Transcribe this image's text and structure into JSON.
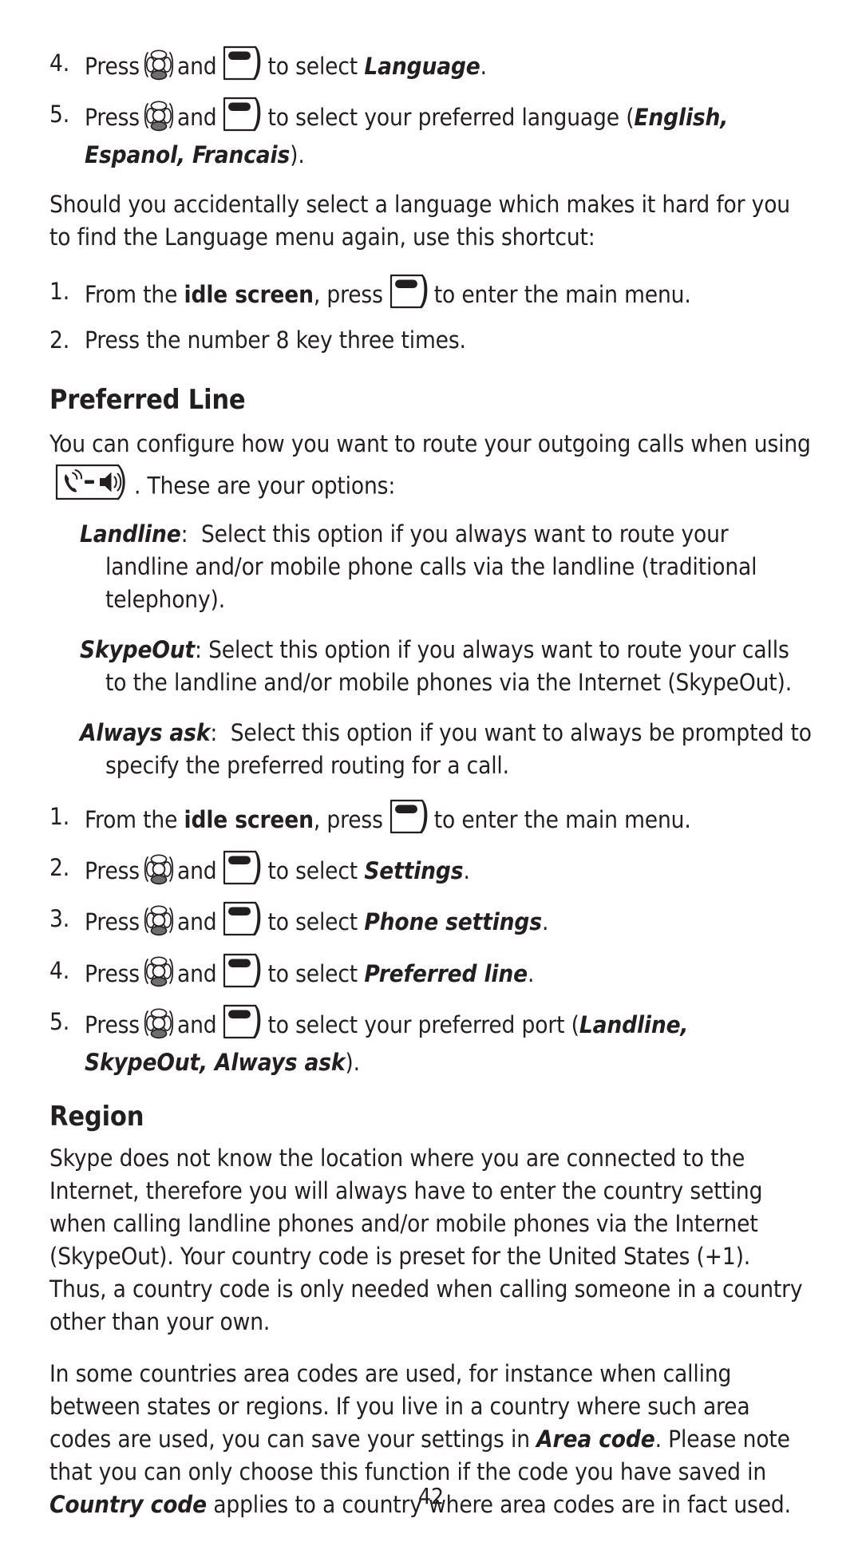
{
  "page": {
    "number": "42"
  },
  "language_steps": [
    {
      "num": "4.",
      "pre": "Press",
      "icon1": "navigation-key-icon",
      "mid": "and",
      "icon2": "soft-key-icon",
      "post": "to select",
      "emphasis": "Language",
      "tail": "."
    },
    {
      "num": "5.",
      "pre": "Press",
      "icon1": "navigation-key-icon",
      "mid": "and",
      "icon2": "soft-key-icon",
      "post": "to select your preferred language (",
      "emphasis": "English, Espanol, Francais",
      "tail": ")."
    }
  ],
  "shortcut": {
    "intro": "Should you accidentally select a language which makes it hard for you to find the Language menu again, use this shortcut:",
    "steps": [
      {
        "num": "1.",
        "pre": "From the",
        "emphasis": "idle screen",
        "mid": ", press",
        "icon": "soft-key-icon",
        "post": "to enter the main menu."
      },
      {
        "num": "2.",
        "text": "Press the number 8 key three times."
      }
    ]
  },
  "preferred_line": {
    "heading": "Preferred Line",
    "intro_before": "You can configure how you want to route your outgoing calls when using",
    "intro_icon": "handset-speaker-key-icon",
    "intro_after": ". These are your options:",
    "options": [
      {
        "term": "Landline",
        "sep": ":",
        "description": "Select this option if you always want to route your landline and/or mobile phone calls via the landline (traditional telephony)."
      },
      {
        "term": "SkypeOut",
        "sep": ":",
        "description": "Select this option if you always want to route your calls to the landline and/or mobile phones via the Internet (SkypeOut)."
      },
      {
        "term": "Always ask",
        "sep": ":",
        "description": "Select this option if you want to always be prompted to specify the preferred routing for a call."
      }
    ],
    "steps": [
      {
        "num": "1.",
        "pre": "From the",
        "emphasis": "idle screen",
        "mid": ", press",
        "icon1": "soft-key-icon",
        "post": "to enter the main menu.",
        "tail": ""
      },
      {
        "num": "2.",
        "pre": "Press",
        "icon0": "navigation-key-icon",
        "mid": "and",
        "icon1": "soft-key-icon",
        "post": "to select",
        "emphasis2": "Settings",
        "tail": "."
      },
      {
        "num": "3.",
        "pre": "Press",
        "icon0": "navigation-key-icon",
        "mid": "and",
        "icon1": "soft-key-icon",
        "post": "to select",
        "emphasis2": "Phone settings",
        "tail": "."
      },
      {
        "num": "4.",
        "pre": "Press",
        "icon0": "navigation-key-icon",
        "mid": "and",
        "icon1": "soft-key-icon",
        "post": "to select",
        "emphasis2": "Preferred line",
        "tail": "."
      },
      {
        "num": "5.",
        "pre": "Press",
        "icon0": "navigation-key-icon",
        "mid": "and",
        "icon1": "soft-key-icon",
        "post": "to select your preferred port (",
        "emphasis2": "Landline, SkypeOut, Always ask",
        "tail": ")."
      }
    ]
  },
  "region": {
    "heading": "Region",
    "paragraph1": "Skype does not know the location where you are connected to the Internet, therefore you will always have to enter the country setting when calling landline phones and/or mobile phones via the Internet (SkypeOut). Your country code is preset for the United States (+1). Thus, a country code is only needed when calling someone in a country other than your own.",
    "paragraph2_part1": "In some countries area codes are used, for instance when calling between states or regions. If you live in a country where such area codes are used, you can save your settings in ",
    "paragraph2_em1": "Area code",
    "paragraph2_part2": ". Please note that you can only choose this function if the code you have saved in ",
    "paragraph2_em2": "Country code",
    "paragraph2_part3": " applies to a country where area codes are in fact used."
  },
  "colors": {
    "text": "#231f20",
    "icon_fill": "#6d6e71",
    "background": "#ffffff"
  }
}
